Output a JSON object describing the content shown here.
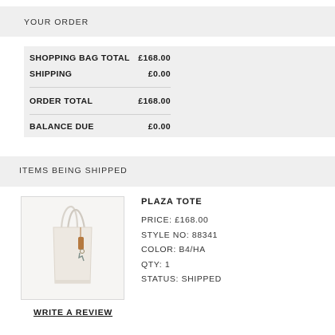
{
  "order_section": {
    "header": "YOUR ORDER"
  },
  "summary": {
    "rows": [
      {
        "label": "SHOPPING BAG TOTAL",
        "value": "£168.00"
      },
      {
        "label": "SHIPPING",
        "value": "£0.00"
      },
      {
        "label": "ORDER TOTAL",
        "value": "£168.00"
      },
      {
        "label": "BALANCE DUE",
        "value": "£0.00"
      }
    ]
  },
  "shipping_section": {
    "header": "ITEMS BEING SHIPPED"
  },
  "item": {
    "name": "PLAZA TOTE",
    "price": "PRICE: £168.00",
    "style": "STYLE NO: 88341",
    "color": "COLOR: B4/HA",
    "qty": "QTY: 1",
    "status": "STATUS: SHIPPED",
    "image_icon": "tote-bag-image"
  },
  "review_link": "WRITE A REVIEW"
}
